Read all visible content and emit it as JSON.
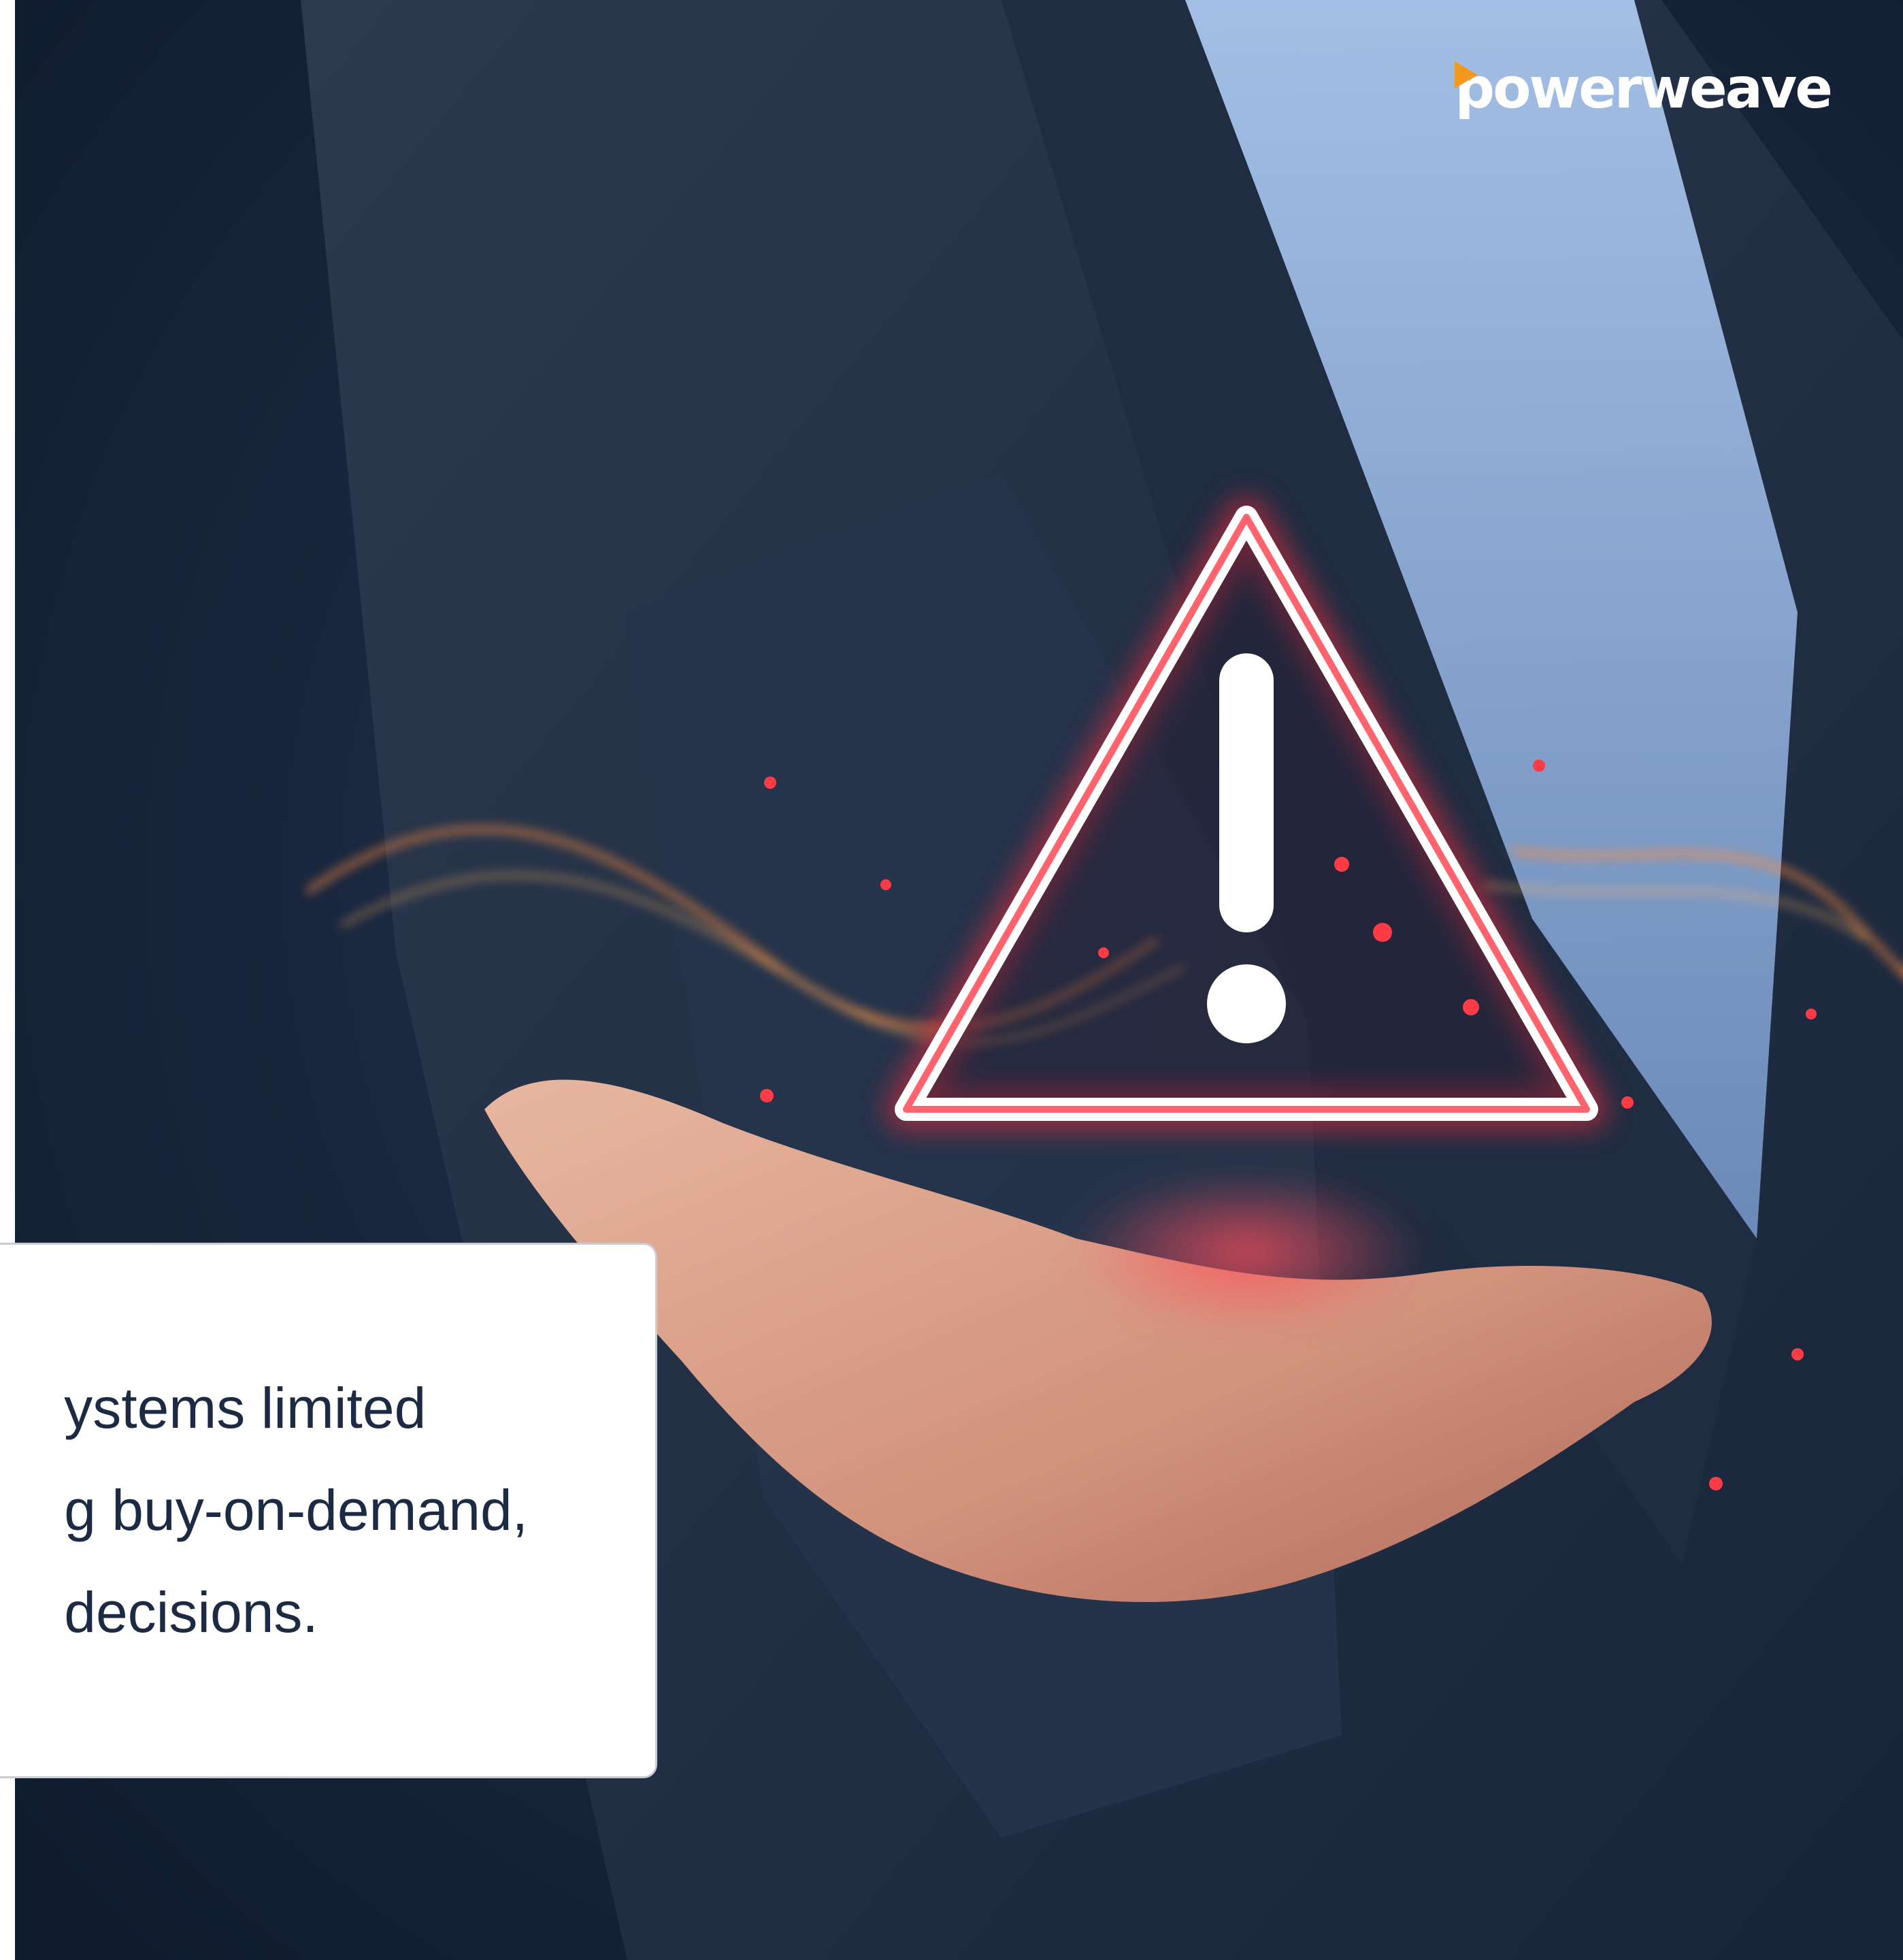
{
  "brand": {
    "logo_text": "powerweave",
    "accent_color": "#f39a1e"
  },
  "callout": {
    "lines": [
      "ystems limited",
      "g buy-on-demand,",
      "decisions."
    ]
  },
  "hero_image": {
    "subject": "warning-triangle-icon",
    "accent_color": "#ff2a3a",
    "background_color": "#1a2840"
  }
}
